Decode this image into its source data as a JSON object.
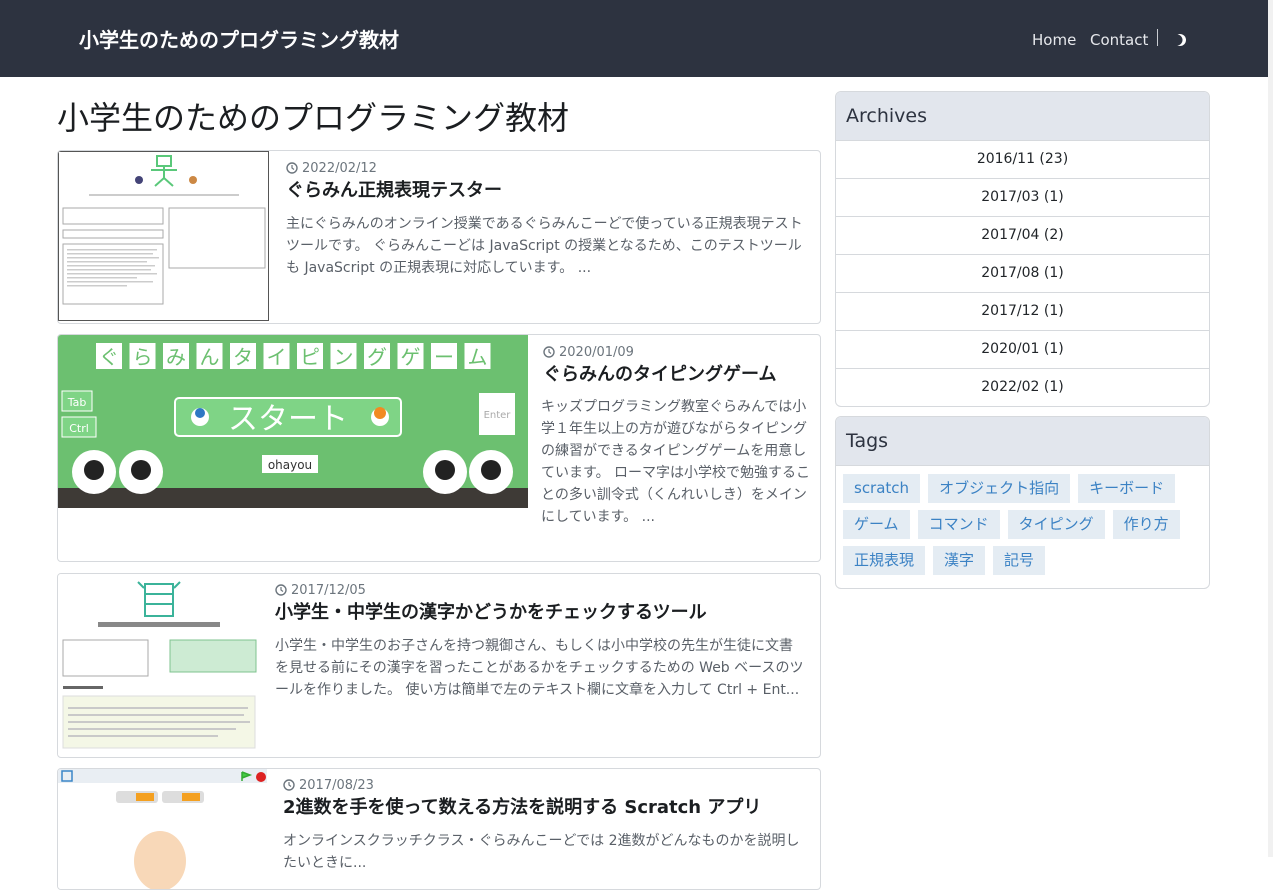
{
  "site": {
    "brand": "小学生のためのプログラミング教材",
    "nav": {
      "home": "Home",
      "contact": "Contact"
    }
  },
  "main": {
    "heading": "小学生のためのプログラミング教材",
    "posts": [
      {
        "date": "2022/02/12",
        "title": "ぐらみん正規表現テスター",
        "excerpt": "主にぐらみんのオンライン授業であるぐらみんこーどで使っている正規表現テストツールです。 ぐらみんこーどは JavaScript の授業となるため、このテストツールも JavaScript の正規表現に対応しています。 ..."
      },
      {
        "date": "2020/01/09",
        "title": "ぐらみんのタイピングゲーム",
        "excerpt": "キッズプログラミング教室ぐらみんでは小学１年生以上の方が遊びながらタイピングの練習ができるタイピングゲームを用意しています。 ローマ字は小学校で勉強することの多い訓令式（くんれいしき）をメインにしています。 ...",
        "thumb": {
          "banner_chars": [
            "ぐ",
            "ら",
            "み",
            "ん",
            "タ",
            "イ",
            "ピ",
            "ン",
            "グ",
            "ゲ",
            "ー",
            "ム"
          ],
          "start_label": "スタート",
          "tab_key": "Tab",
          "ctrl_key": "Ctrl",
          "enter_key": "Enter",
          "word": "ohayou"
        }
      },
      {
        "date": "2017/12/05",
        "title": "小学生・中学生の漢字かどうかをチェックするツール",
        "excerpt": "小学生・中学生のお子さんを持つ親御さん、もしくは小中学校の先生が生徒に文書を見せる前にその漢字を習ったことがあるかをチェックするための Web ベースのツールを作りました。 使い方は簡単で左のテキスト欄に文章を入力して Ctrl + Ent..."
      },
      {
        "date": "2017/08/23",
        "title": "2進数を手を使って数える方法を説明する Scratch アプリ",
        "excerpt": "オンラインスクラッチクラス・ぐらみんこーどでは 2進数がどんなものかを説明したいときに..."
      }
    ]
  },
  "sidebar": {
    "archives": {
      "title": "Archives",
      "items": [
        "2016/11 (23)",
        "2017/03 (1)",
        "2017/04 (2)",
        "2017/08 (1)",
        "2017/12 (1)",
        "2020/01 (1)",
        "2022/02 (1)"
      ]
    },
    "tags": {
      "title": "Tags",
      "items": [
        "scratch",
        "オブジェクト指向",
        "キーボード",
        "ゲーム",
        "コマンド",
        "タイピング",
        "作り方",
        "正規表現",
        "漢字",
        "記号"
      ]
    }
  },
  "colors": {
    "navbar": "#2d3340",
    "tag_bg": "#e4ecf3",
    "tag_text": "#3b82c4",
    "game_green": "#6cc070"
  },
  "icons": {
    "clock": "clock-icon",
    "theme": "moon-icon"
  }
}
